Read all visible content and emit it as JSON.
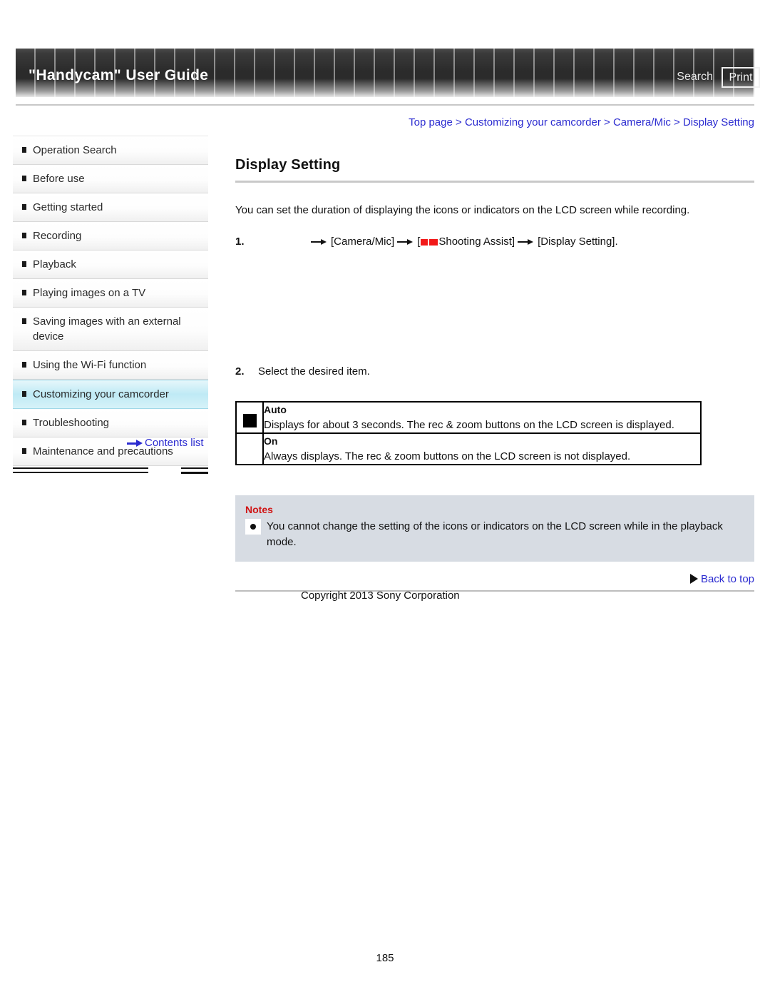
{
  "header": {
    "title": "\"Handycam\" User Guide",
    "search_label": "Search",
    "print_label": "Print"
  },
  "breadcrumb": {
    "items": [
      "Top page",
      "Customizing your camcorder",
      "Camera/Mic",
      "Display Setting"
    ],
    "separator": ">",
    "link_color": "#2b2bd0"
  },
  "sidebar": {
    "items": [
      {
        "label": "Operation Search",
        "selected": false
      },
      {
        "label": "Before use",
        "selected": false
      },
      {
        "label": "Getting started",
        "selected": false
      },
      {
        "label": "Recording",
        "selected": false
      },
      {
        "label": "Playback",
        "selected": false
      },
      {
        "label": "Playing images on a TV",
        "selected": false
      },
      {
        "label": "Saving images with an external device",
        "selected": false
      },
      {
        "label": "Using the Wi-Fi function",
        "selected": false
      },
      {
        "label": "Customizing your camcorder",
        "selected": true
      },
      {
        "label": "Troubleshooting",
        "selected": false
      },
      {
        "label": "Maintenance and precautions",
        "selected": false
      }
    ],
    "contents_link": "Contents list",
    "selected_highlight_color": "#bfeaf5"
  },
  "main": {
    "page_title": "Display Setting",
    "intro": "You can set the duration of displaying the icons or indicators on the LCD screen while recording.",
    "step1": {
      "number": "1.",
      "part_a": "[Camera/Mic]",
      "part_b_open": "[",
      "part_b_label": "Shooting Assist]",
      "part_c": "[Display Setting].",
      "icon_color": "#f21919"
    },
    "step2": {
      "number": "2.",
      "text": "Select the desired item."
    },
    "options": [
      {
        "marked": true,
        "name": "Auto",
        "description": "Displays for about 3 seconds. The rec & zoom buttons on the LCD screen is displayed."
      },
      {
        "marked": false,
        "name": "On",
        "description": "Always displays. The rec & zoom buttons on the LCD screen is not displayed."
      }
    ],
    "notes": {
      "title": "Notes",
      "title_color": "#d01414",
      "items": [
        "You cannot change the setting of the icons or indicators on the LCD screen while in the playback mode."
      ]
    },
    "back_to_top": "Back to top"
  },
  "footer": {
    "copyright": "Copyright 2013 Sony Corporation",
    "page_number": "185"
  }
}
